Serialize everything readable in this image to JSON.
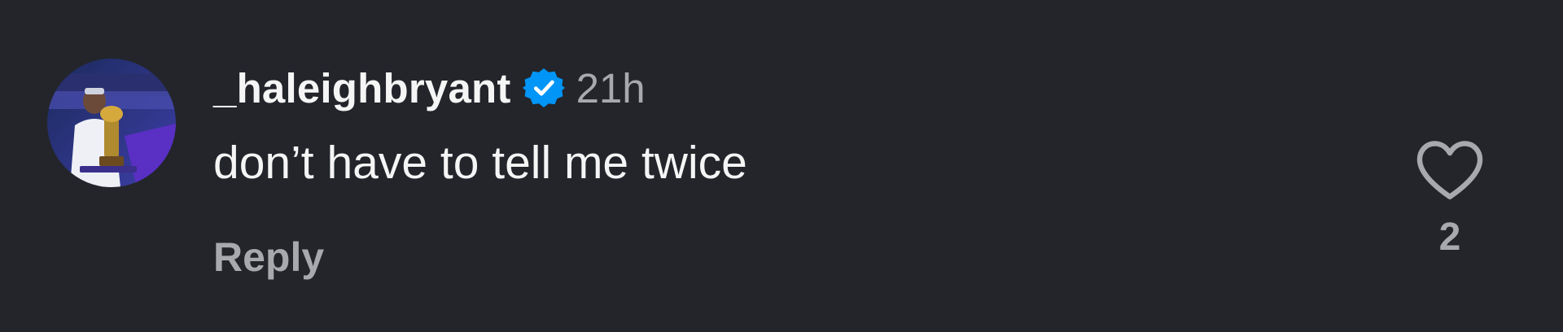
{
  "comment": {
    "username": "_haleighbryant",
    "verified_icon": "verified-badge-icon",
    "timestamp": "21h",
    "text": "don’t have to tell me twice",
    "reply_label": "Reply",
    "like_icon": "heart-icon",
    "like_count": "2"
  },
  "colors": {
    "background": "#23252b",
    "primary_text": "#f5f5f5",
    "secondary_text": "#a8a9ad",
    "verified_blue": "#0095f6"
  }
}
